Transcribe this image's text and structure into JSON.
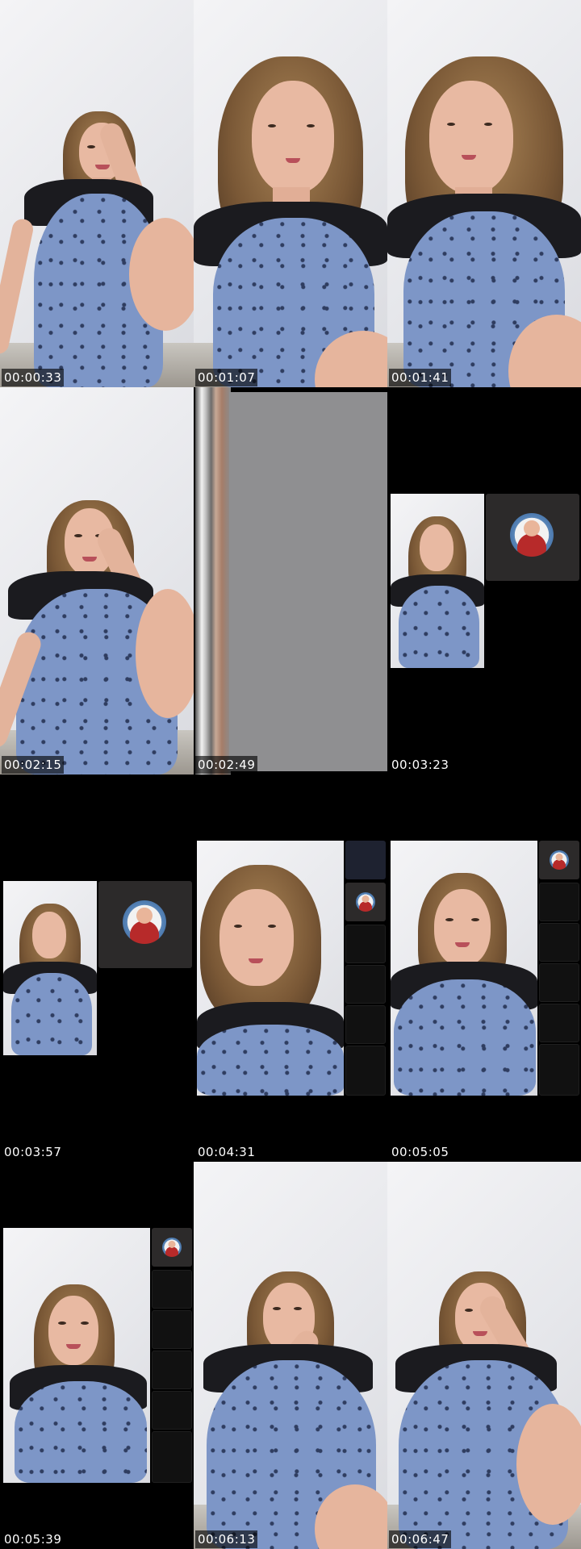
{
  "timestamps": [
    "00:00:33",
    "00:01:07",
    "00:01:41",
    "00:02:15",
    "00:02:49",
    "00:03:23",
    "00:03:57",
    "00:04:31",
    "00:05:05",
    "00:05:39",
    "00:06:13",
    "00:06:47"
  ],
  "colors": {
    "background": "#000000",
    "wall": "#eceef1",
    "dress": "#7d96c7",
    "hair": "#8a6440",
    "placeholder_grey": "#8f8f91",
    "call_tile": "#2c2a2a"
  },
  "icons": [
    "avatar-icon"
  ]
}
